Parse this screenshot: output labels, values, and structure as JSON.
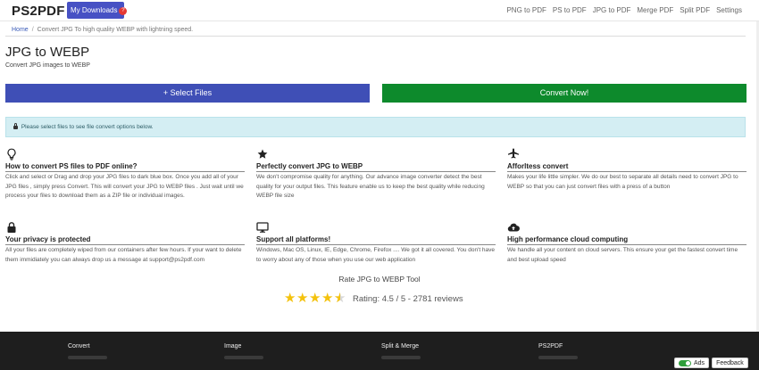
{
  "nav": {
    "logo": "PS2PDF",
    "downloads_label": "My Downloads",
    "downloads_count": "?",
    "links": [
      "PNG to PDF",
      "PS to PDF",
      "JPG to PDF",
      "Merge PDF",
      "Split PDF",
      "Settings"
    ]
  },
  "breadcrumb": {
    "home": "Home",
    "current": "Convert JPG To high quality WEBP with lightning speed."
  },
  "page": {
    "title": "JPG to WEBP",
    "subtitle": "Convert JPG images to WEBP"
  },
  "actions": {
    "select_files": "+  Select Files",
    "convert_now": "Convert Now!"
  },
  "alert": {
    "text": "Please select files to see file convert options below."
  },
  "features": [
    {
      "icon": "lightbulb-icon",
      "title": "How to convert PS files to PDF online?",
      "text": "Click and select or Drag and drop your JPG files to dark blue box. Once you add all of your JPG files , simply press Convert. This will convert your JPG to WEBP files . Just wait until we process your files to download them as a ZIP file or individual images."
    },
    {
      "icon": "star-icon",
      "title": "Perfectly convert JPG to WEBP",
      "text": "We don't compromise quality for anything. Our advance image converter detect the best quality for your output files. This feature enable us to keep the best quality while reducing WEBP file size"
    },
    {
      "icon": "airplane-icon",
      "title": "Afforltess convert",
      "text": "Makes your life little simpler. We do our best to separate all details need to convert JPG to WEBP so that you can just convert files with a press of a button"
    },
    {
      "icon": "lock-icon",
      "title": "Your privacy is protected",
      "text": "All your files are completely wiped from our containers after few hours. If your want to delete them immidiately you can always drop us a message at support@ps2pdf.com"
    },
    {
      "icon": "monitor-icon",
      "title": "Support all platforms!",
      "text": "Windows, Mac OS, Linux, IE, Edge, Chrome, Firefox .... We got it all covered. You don't have to worry about any of those when you use our web application"
    },
    {
      "icon": "cloud-upload-icon",
      "title": "High performance cloud computing",
      "text": "We handle all your content on cloud servers. This ensure your get the fastest convert time and best upload speed"
    }
  ],
  "rating": {
    "title": "Rate JPG to WEBP Tool",
    "stars_value": 4.5,
    "text": "Rating: 4.5 / 5 - 2781 reviews"
  },
  "footer": {
    "columns": [
      "Convert",
      "Image",
      "Split & Merge",
      "PS2PDF"
    ]
  },
  "widget": {
    "ads_label": "Ads",
    "feedback_label": "Feedback"
  },
  "colors": {
    "select_button": "#3f4fb6",
    "convert_button": "#0d8a2c",
    "alert_bg": "#d4eef3",
    "star": "#f4c20d",
    "footer_bg": "#1e1e1e"
  }
}
